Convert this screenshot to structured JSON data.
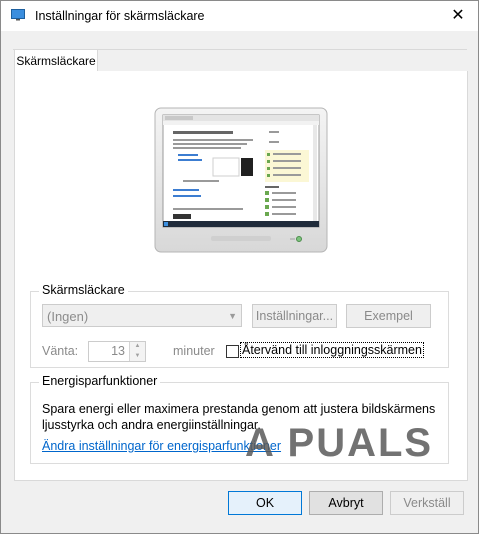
{
  "window": {
    "title": "Inställningar för skärmsläckare"
  },
  "tabs": [
    {
      "label": "Skärmsläckare"
    }
  ],
  "screensaver": {
    "group_label": "Skärmsläckare",
    "selected": "(Ingen)",
    "settings_button": "Inställningar...",
    "preview_button": "Exempel",
    "wait_label": "Vänta:",
    "wait_value": "13",
    "minutes_label": "minuter",
    "resume_checkbox_label": "Återvänd till inloggningsskärmen",
    "resume_checked": false
  },
  "power": {
    "group_label": "Energisparfunktioner",
    "description": "Spara energi eller maximera prestanda genom att justera bildskärmens ljusstyrka och andra energiinställningar.",
    "link": "Ändra inställningar för energisparfunktioner"
  },
  "watermark": "A PUALS",
  "buttons": {
    "ok": "OK",
    "cancel": "Avbryt",
    "apply": "Verkställ"
  },
  "colors": {
    "accent": "#0078d7",
    "link": "#0066cc",
    "disabled_text": "#8a8a8a"
  }
}
